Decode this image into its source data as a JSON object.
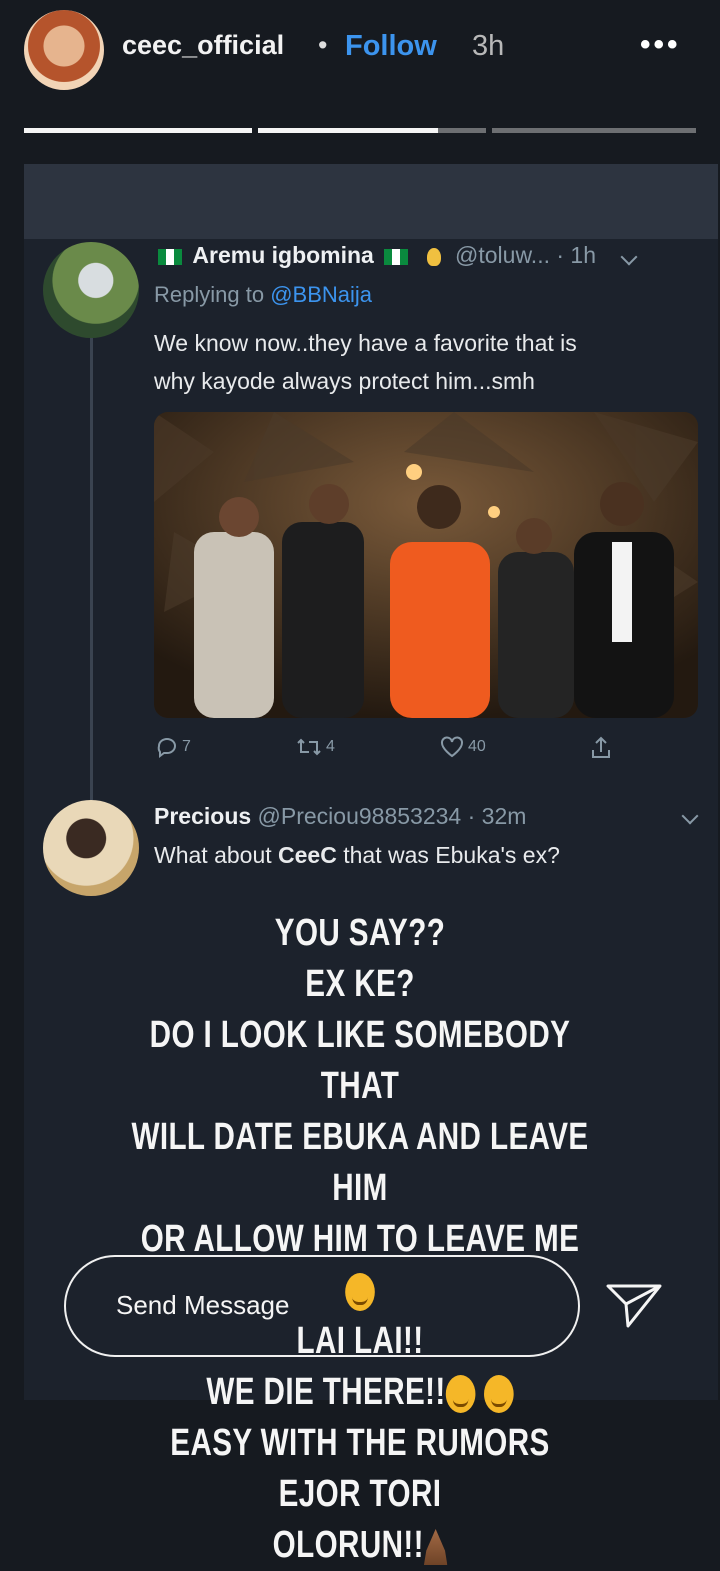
{
  "header": {
    "username": "ceec_official",
    "separator": "•",
    "follow_label": "Follow",
    "time": "3h",
    "more_icon": "•••"
  },
  "progress": {
    "segments": 3,
    "active_index": 1,
    "active_fill": 0.9
  },
  "tweet1": {
    "author": "Aremu igbomina",
    "handle": "@toluw...",
    "time": "· 1h",
    "replying_prefix": "Replying to",
    "replying_to": "@BBNaija",
    "text_line1": "We know now..they have a favorite that is",
    "text_line2": "why kayode always protect him...smh",
    "replies": "7",
    "retweets": "4",
    "likes": "40"
  },
  "tweet2": {
    "author": "Precious",
    "handle": "@Preciou98853234",
    "time": "· 32m",
    "text_prefix": "What about ",
    "text_bold": "CeeC",
    "text_suffix": " that was Ebuka's ex?"
  },
  "caption": {
    "l1": "YOU SAY??",
    "l2": "EX KE?",
    "l3": "DO I LOOK LIKE SOMEBODY THAT",
    "l4": "WILL DATE EBUKA AND LEAVE HIM",
    "l5": "OR ALLOW HIM TO LEAVE ME",
    "l6": "LAI LAI!!",
    "l7": "WE DIE THERE!!",
    "l8": "EASY WITH THE RUMORS EJOR TORI",
    "l9": "OLORUN!!"
  },
  "composer": {
    "placeholder": "Send Message"
  },
  "colors": {
    "accent": "#3c94ee",
    "background": "#161a20",
    "tweet_panel": "#1c222c"
  }
}
